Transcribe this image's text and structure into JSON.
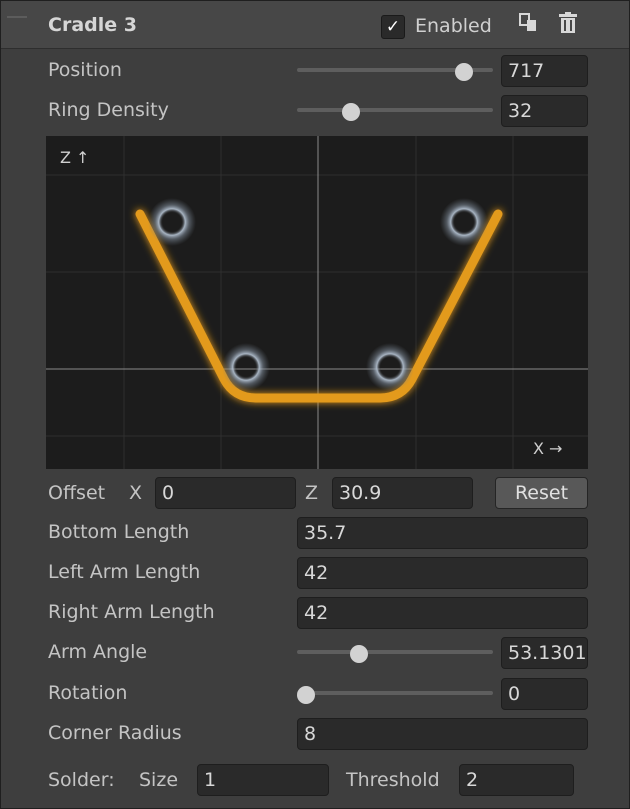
{
  "header": {
    "title": "Cradle 3",
    "enabled_label": "Enabled",
    "enabled_checked": "✓"
  },
  "position": {
    "label": "Position",
    "value": "717",
    "slider_fraction": 0.89
  },
  "ring_density": {
    "label": "Ring Density",
    "value": "32",
    "slider_fraction": 0.25
  },
  "viewport": {
    "z_axis_label": "Z ↑",
    "x_axis_label": "X →",
    "curve_color": "#e8a020",
    "handle_color": "#a7b6c6"
  },
  "offset": {
    "label": "Offset",
    "x_label": "X",
    "x_value": "0",
    "z_label": "Z",
    "z_value": "30.9",
    "reset_label": "Reset"
  },
  "bottom_length": {
    "label": "Bottom Length",
    "value": "35.7"
  },
  "left_arm_length": {
    "label": "Left Arm Length",
    "value": "42"
  },
  "right_arm_length": {
    "label": "Right Arm Length",
    "value": "42"
  },
  "arm_angle": {
    "label": "Arm Angle",
    "value": "53.1301",
    "slider_fraction": 0.3
  },
  "rotation": {
    "label": "Rotation",
    "value": "0",
    "slider_fraction": 0.0
  },
  "corner_radius": {
    "label": "Corner Radius",
    "value": "8"
  },
  "solder": {
    "label": "Solder:",
    "size_label": "Size",
    "size_value": "1",
    "threshold_label": "Threshold",
    "threshold_value": "2"
  }
}
